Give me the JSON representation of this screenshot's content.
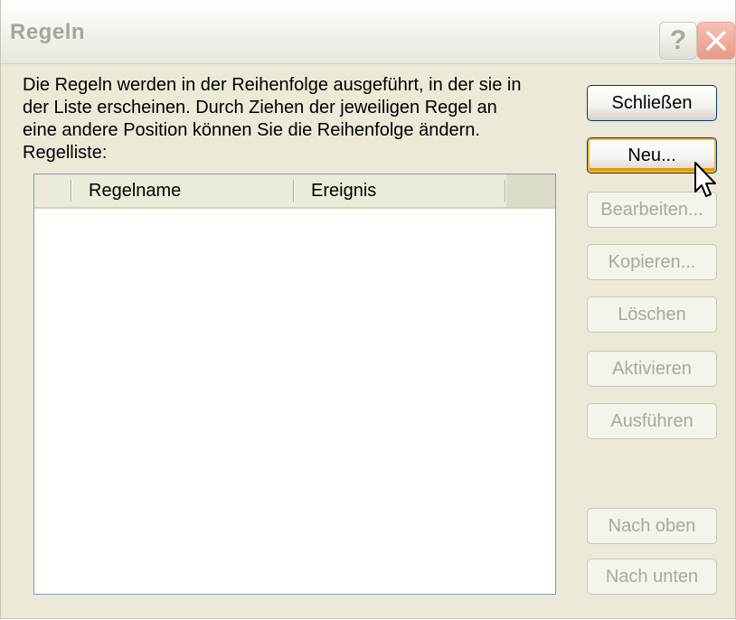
{
  "window": {
    "title": "Regeln"
  },
  "caption_buttons": {
    "help_glyph": "?",
    "close_icon": "close-icon"
  },
  "description": "Die Regeln werden in der Reihenfolge ausgeführt, in der sie in\nder Liste erscheinen. Durch Ziehen der jeweiligen Regel an\neine andere Position können Sie die Reihenfolge ändern.\nRegelliste:",
  "rules_list": {
    "columns": [
      "",
      "Regelname",
      "Ereignis"
    ],
    "rows": []
  },
  "buttons": {
    "close": "Schließen",
    "new": "Neu...",
    "edit": "Bearbeiten...",
    "copy": "Kopieren...",
    "delete": "Löschen",
    "activate": "Aktivieren",
    "run": "Ausführen",
    "move_up": "Nach oben",
    "move_down": "Nach unten"
  },
  "colors": {
    "dialog_bg": "#ece9d8",
    "button_border": "#003c74",
    "hover_orange": "#f8b33a",
    "disabled_text": "#aca899"
  }
}
